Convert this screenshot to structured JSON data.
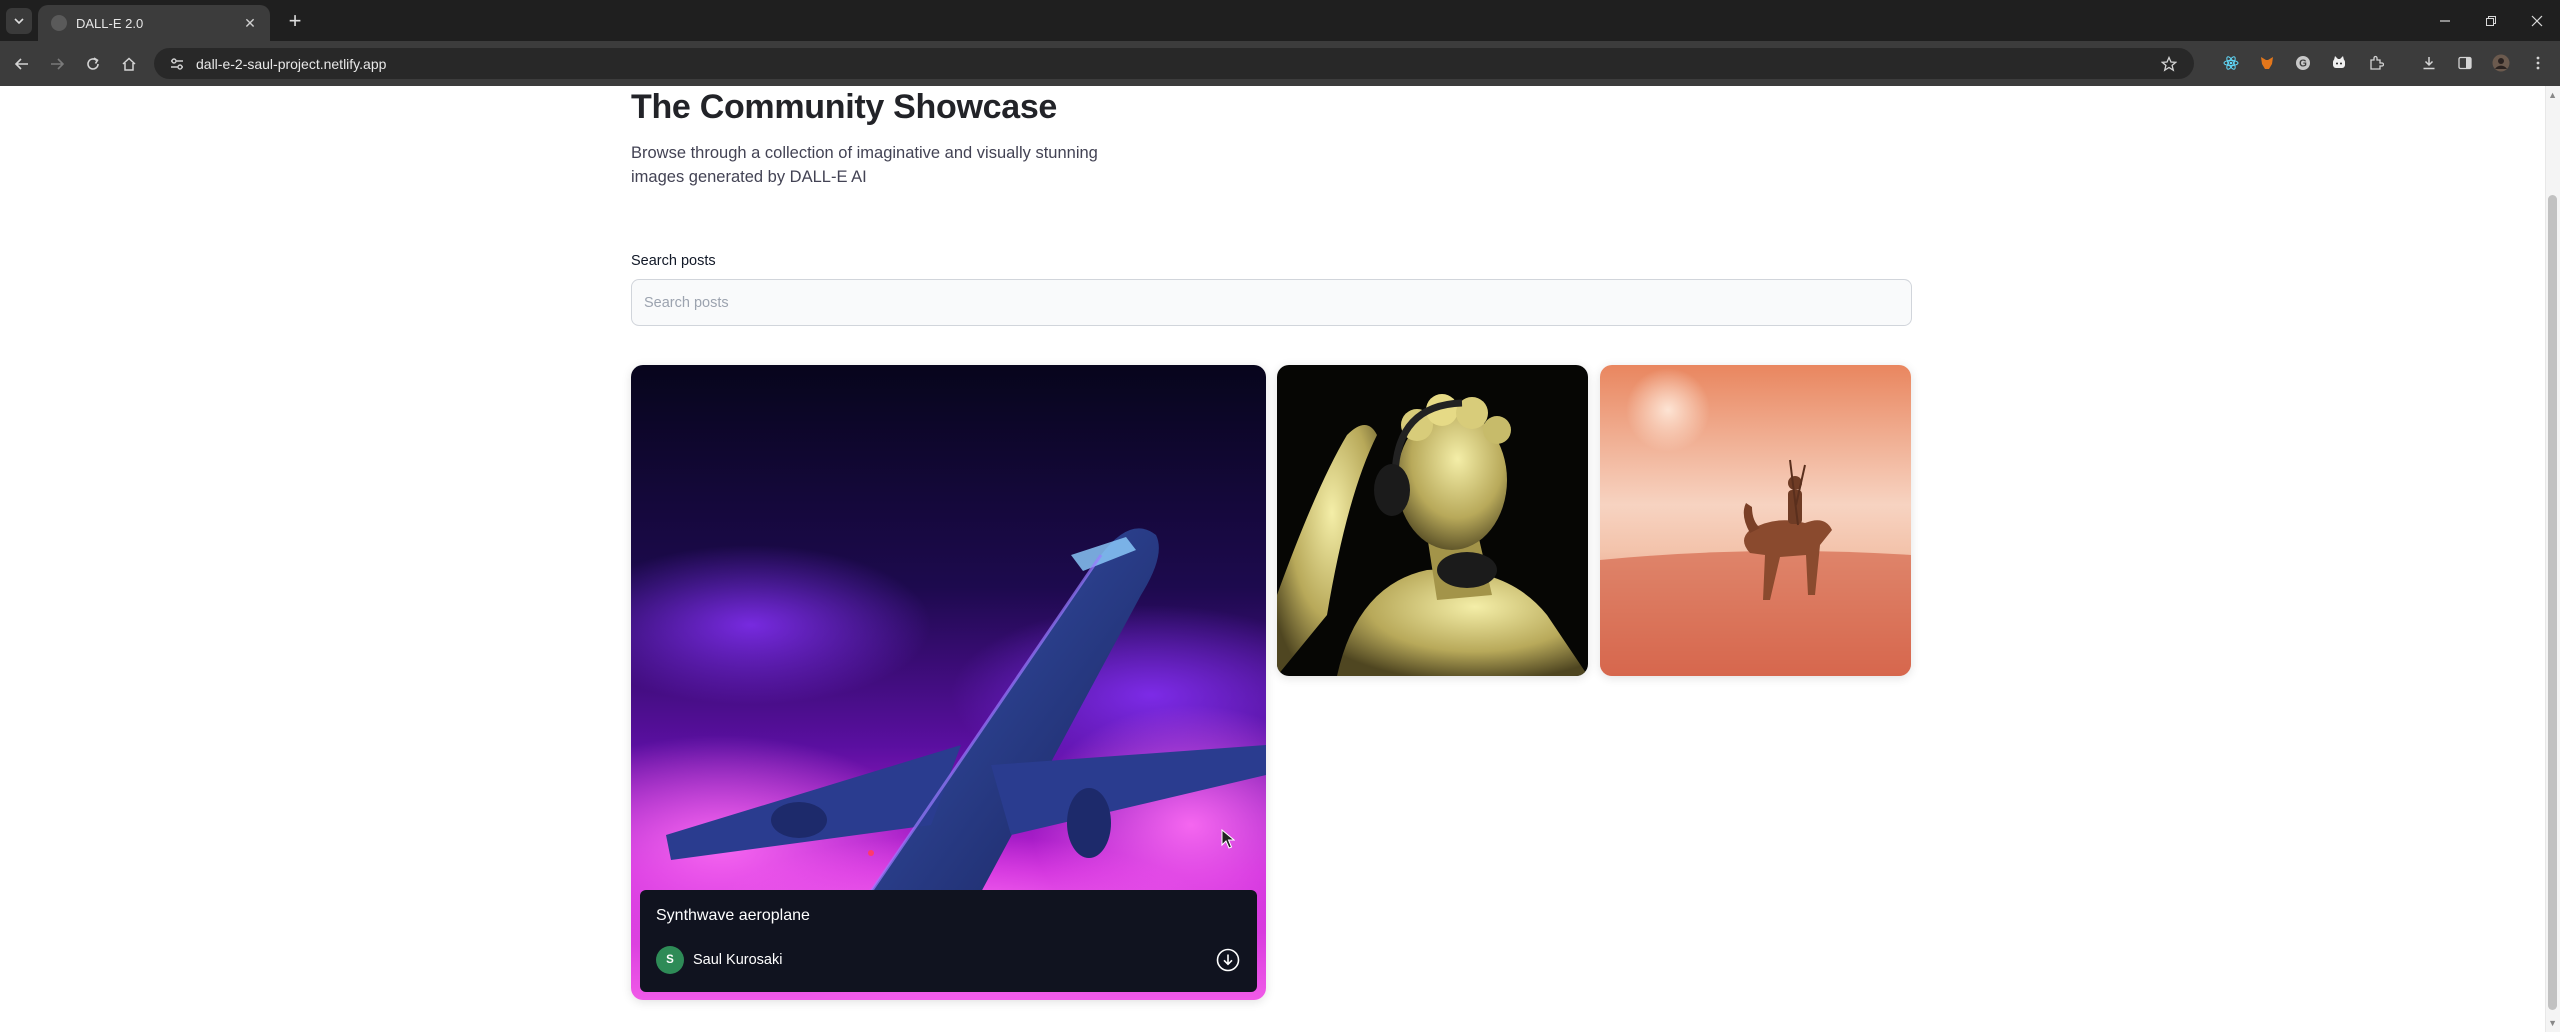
{
  "browser": {
    "tab_title": "DALL-E 2.0",
    "url": "dall-e-2-saul-project.netlify.app"
  },
  "page": {
    "title": "The Community Showcase",
    "subtitle": "Browse through a collection of imaginative and visually stunning images generated by DALL-E AI",
    "search": {
      "label": "Search posts",
      "placeholder": "Search posts",
      "value": ""
    }
  },
  "posts": [
    {
      "prompt": "Synthwave aeroplane",
      "author": "Saul Kurosaki",
      "author_initial": "S",
      "image_icon": "synthwave-aeroplane-image"
    },
    {
      "image_icon": "greek-statue-headphones-image"
    },
    {
      "image_icon": "desert-horse-rider-image"
    }
  ],
  "colors": {
    "avatar": "#2e8b57",
    "overlay": "#10131f",
    "title": "#222328",
    "chrome_dark": "#1f1f1f",
    "chrome_toolbar": "#3c3c3c"
  }
}
